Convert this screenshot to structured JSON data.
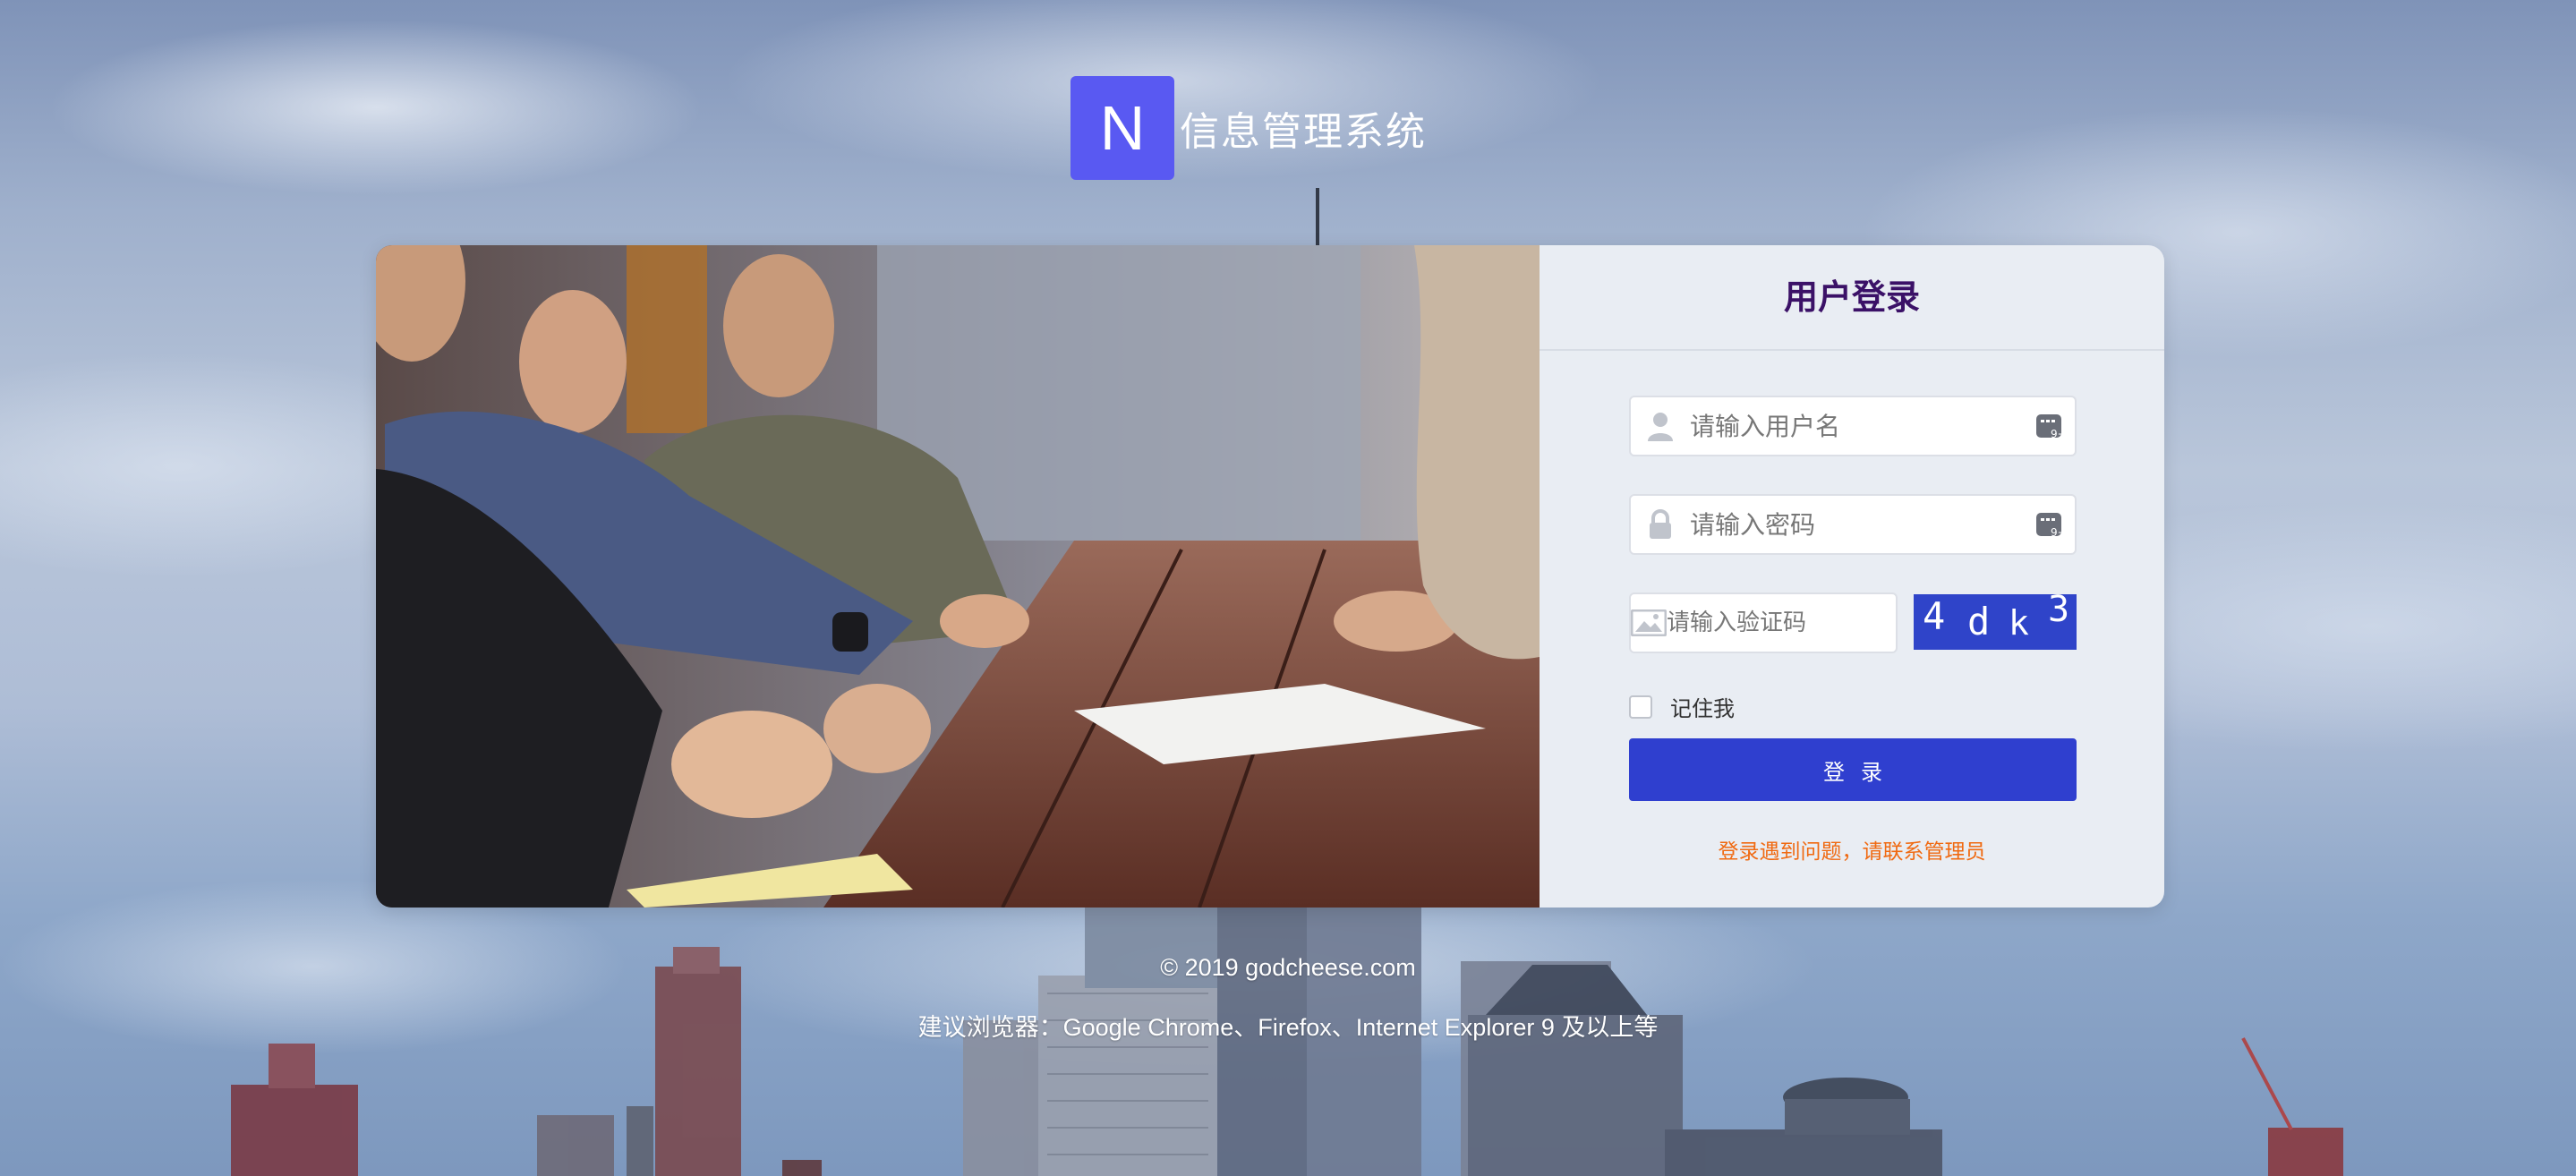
{
  "app": {
    "logo_letter": "N",
    "title": "信息管理系统"
  },
  "login": {
    "heading": "用户登录",
    "username_placeholder": "请输入用户名",
    "password_placeholder": "请输入密码",
    "captcha_placeholder": "请输入验证码",
    "captcha_chars": [
      "4",
      "d",
      "k",
      "3"
    ],
    "remember_label": "记住我",
    "remember_checked": false,
    "submit_label": "登录",
    "help_text": "登录遇到问题，请联系管理员"
  },
  "footer": {
    "copyright": "© 2019 godcheese.com",
    "browser_hint": "建议浏览器：Google Chrome、Firefox、Internet Explorer 9 及以上等"
  },
  "colors": {
    "brand": "#5959f2",
    "heading": "#3b1167",
    "button": "#2f3fcf",
    "captcha_bg": "#2f44c9",
    "help_link": "#f06a12",
    "panel_bg": "#e9edf3"
  },
  "icons": {
    "username_field": "user-icon",
    "password_field": "lock-icon",
    "captcha_field": "image-icon",
    "field_trailing": "keyboard-badge-icon"
  }
}
